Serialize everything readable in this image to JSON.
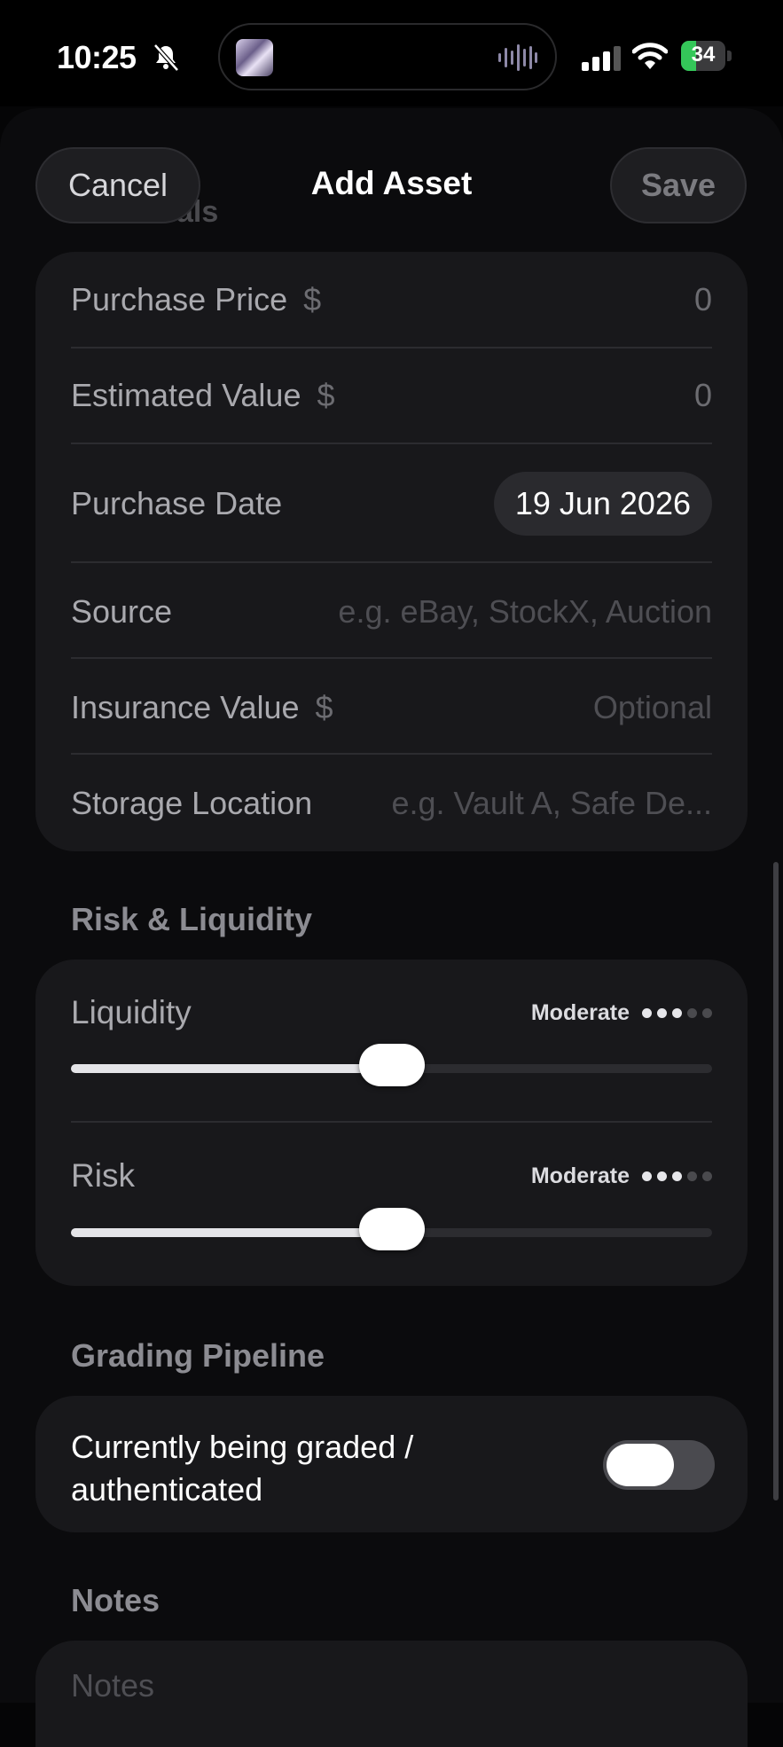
{
  "status_bar": {
    "time": "10:25",
    "battery": "34",
    "battery_level": 0.34
  },
  "nav": {
    "cancel": "Cancel",
    "title": "Add Asset",
    "save": "Save"
  },
  "financials": {
    "section_title": "Financials",
    "purchase_price": {
      "label": "Purchase Price",
      "currency": "$",
      "value": "0"
    },
    "estimated_value": {
      "label": "Estimated Value",
      "currency": "$",
      "value": "0"
    },
    "purchase_date": {
      "label": "Purchase Date",
      "value": "19 Jun 2026"
    },
    "source": {
      "label": "Source",
      "placeholder": "e.g. eBay, StockX, Auction"
    },
    "insurance_value": {
      "label": "Insurance Value",
      "currency": "$",
      "placeholder": "Optional"
    },
    "storage_location": {
      "label": "Storage Location",
      "placeholder": "e.g. Vault A, Safe De..."
    }
  },
  "risk_liquidity": {
    "section_title": "Risk & Liquidity",
    "liquidity": {
      "label": "Liquidity",
      "level_text": "Moderate",
      "level": 3,
      "max": 5,
      "fraction": 0.5
    },
    "risk": {
      "label": "Risk",
      "level_text": "Moderate",
      "level": 3,
      "max": 5,
      "fraction": 0.5
    }
  },
  "grading": {
    "section_title": "Grading Pipeline",
    "toggle_label": "Currently being graded / authenticated",
    "toggle_on": false
  },
  "notes": {
    "section_title": "Notes",
    "placeholder": "Notes"
  }
}
